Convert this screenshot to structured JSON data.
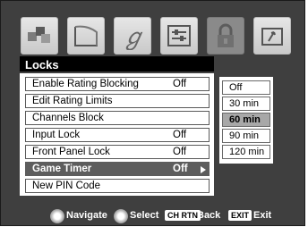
{
  "menu": {
    "title": "Locks",
    "items": [
      {
        "label": "Enable Rating Blocking",
        "value": "Off"
      },
      {
        "label": "Edit Rating Limits",
        "value": ""
      },
      {
        "label": "Channels Block",
        "value": ""
      },
      {
        "label": "Input Lock",
        "value": "Off"
      },
      {
        "label": "Front Panel Lock",
        "value": "Off"
      },
      {
        "label": "Game Timer",
        "value": "Off"
      },
      {
        "label": "New PIN Code",
        "value": ""
      }
    ],
    "selected_index": 5
  },
  "submenu": {
    "options": [
      "Off",
      "30 min",
      "60 min",
      "90 min",
      "120 min"
    ],
    "selected": "60 min"
  },
  "navbar": {
    "navigate": "Navigate",
    "select": "Select",
    "back_key": "CH RTN",
    "back": "Back",
    "exit_key": "EXIT",
    "exit": "Exit"
  },
  "icons": [
    "picture-menu-icon",
    "screen-menu-icon",
    "audio-menu-icon",
    "settings-menu-icon",
    "locks-menu-icon",
    "applications-menu-icon"
  ]
}
